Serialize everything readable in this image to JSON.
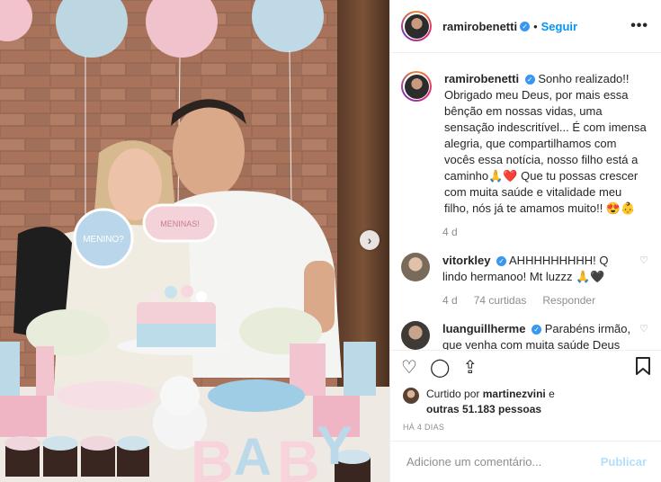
{
  "header": {
    "username": "ramirobenetti",
    "dot": "•",
    "follow_label": "Seguir",
    "more_label": "•••"
  },
  "caption": {
    "username": "ramirobenetti",
    "text": "Sonho realizado!! Obrigado meu Deus, por mais essa bênção em nossas vidas, uma sensação indescritível... É com imensa alegria, que compartilhamos com vocês essa notícia, nosso filho está a caminho🙏❤️ Que tu possas crescer com muita saúde e vitalidade meu filho, nós já te amamos muito!! 😍👶",
    "age": "4 d"
  },
  "comments": [
    {
      "username": "vitorkley",
      "verified": true,
      "text": "AHHHHHHHHH! Q lindo hermanoo! Mt luzzz 🙏🖤",
      "age": "4 d",
      "likes": "74 curtidas",
      "reply": "Responder"
    },
    {
      "username": "luanguillherme",
      "verified": true,
      "text": "Parabéns irmão, que venha com muita saúde Deus abençoe! 🙏",
      "age": "",
      "likes": "",
      "reply": ""
    }
  ],
  "likes": {
    "prefix": "Curtido por",
    "user": "martinezvini",
    "middle": "e",
    "others": "outras 51.183 pessoas"
  },
  "timestamp": "HÁ 4 DIAS",
  "add_comment": {
    "placeholder": "Adicione um comentário...",
    "publish_label": "Publicar"
  },
  "photo": {
    "sign_left": "MENINO?",
    "sign_right": "MENINAS!",
    "baby_letters": [
      "B",
      "A",
      "B",
      "Y"
    ]
  },
  "icons": {
    "like": "heart-icon",
    "comment": "comment-icon",
    "share": "share-icon",
    "save": "bookmark-icon",
    "next": "chevron-right-icon"
  },
  "colors": {
    "accent": "#0095f6",
    "publish_disabled": "#b2dffc",
    "muted": "#8e8e8e"
  }
}
